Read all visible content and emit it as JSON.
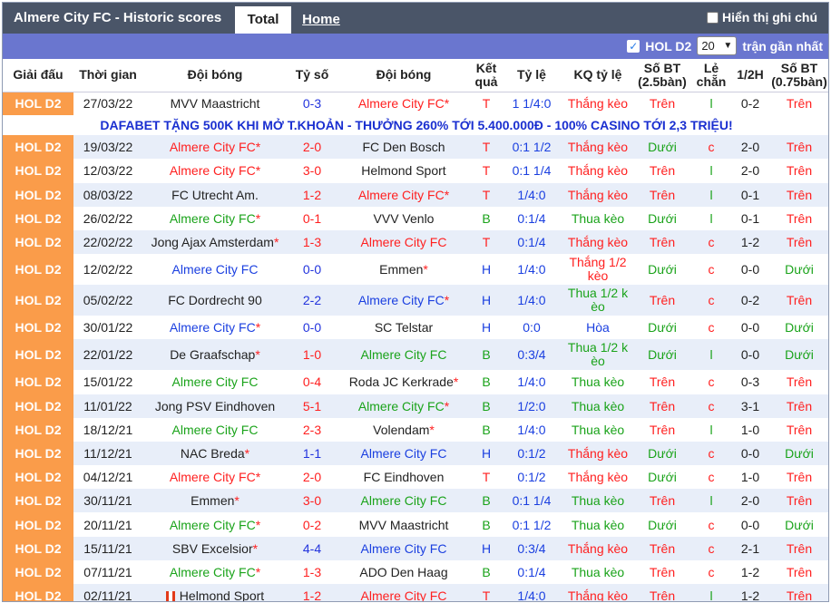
{
  "header": {
    "title": "Almere City FC - Historic scores",
    "tab_total": "Total",
    "tab_home": "Home",
    "hint": "Hiển thị ghi chú"
  },
  "filter": {
    "league": "HOL D2",
    "count": "20",
    "recent": "trận gần nhất"
  },
  "columns": [
    "Giải đấu",
    "Thời gian",
    "Đội bóng",
    "Tỷ số",
    "Đội bóng",
    "Kết quả",
    "Tỷ lệ",
    "KQ tỷ lệ",
    "Số BT (2.5bàn)",
    "Lẻ chẵn",
    "1/2H",
    "Số BT (0.75bàn)"
  ],
  "promo": "DAFABET TẶNG 500K KHI MỞ T.KHOẢN - THƯỞNG 260% TỚI 5.400.000Đ - 100% CASINO TỚI 2,3 TRIỆU!",
  "rows": [
    {
      "league": "HOL D2",
      "date": "27/03/22",
      "home": "MVV Maastricht",
      "home_star": false,
      "home_c": "blk",
      "score": "0-3",
      "sc": "blu",
      "away": "Almere City FC",
      "away_star": true,
      "away_c": "red",
      "res": "T",
      "res_c": "red",
      "odds": "1 1/4:0",
      "odds_c": "blu",
      "kq": "Thắng kèo",
      "kq_c": "red",
      "bt": "Trên",
      "bt_c": "red",
      "lc": "l",
      "lc_c": "grn",
      "h1": "0-2",
      "ou": "Trên",
      "ou_c": "red",
      "tall": false
    },
    {
      "league": "HOL D2",
      "date": "19/03/22",
      "home": "Almere City FC",
      "home_star": true,
      "home_c": "red",
      "score": "2-0",
      "sc": "red",
      "away": "FC Den Bosch",
      "away_star": false,
      "away_c": "blk",
      "res": "T",
      "res_c": "red",
      "odds": "0:1 1/2",
      "odds_c": "blu",
      "kq": "Thắng kèo",
      "kq_c": "red",
      "bt": "Dưới",
      "bt_c": "grn",
      "lc": "c",
      "lc_c": "red",
      "h1": "2-0",
      "ou": "Trên",
      "ou_c": "red",
      "tall": false
    },
    {
      "league": "HOL D2",
      "date": "12/03/22",
      "home": "Almere City FC",
      "home_star": true,
      "home_c": "red",
      "score": "3-0",
      "sc": "red",
      "away": "Helmond Sport",
      "away_star": false,
      "away_c": "blk",
      "res": "T",
      "res_c": "red",
      "odds": "0:1 1/4",
      "odds_c": "blu",
      "kq": "Thắng kèo",
      "kq_c": "red",
      "bt": "Trên",
      "bt_c": "red",
      "lc": "l",
      "lc_c": "grn",
      "h1": "2-0",
      "ou": "Trên",
      "ou_c": "red",
      "tall": false
    },
    {
      "league": "HOL D2",
      "date": "08/03/22",
      "home": "FC Utrecht Am.",
      "home_star": false,
      "home_c": "blk",
      "score": "1-2",
      "sc": "red",
      "away": "Almere City FC",
      "away_star": true,
      "away_c": "red",
      "res": "T",
      "res_c": "red",
      "odds": "1/4:0",
      "odds_c": "blu",
      "kq": "Thắng kèo",
      "kq_c": "red",
      "bt": "Trên",
      "bt_c": "red",
      "lc": "l",
      "lc_c": "grn",
      "h1": "0-1",
      "ou": "Trên",
      "ou_c": "red",
      "tall": false
    },
    {
      "league": "HOL D2",
      "date": "26/02/22",
      "home": "Almere City FC",
      "home_star": true,
      "home_c": "grn",
      "score": "0-1",
      "sc": "red",
      "away": "VVV Venlo",
      "away_star": false,
      "away_c": "blk",
      "res": "B",
      "res_c": "grn",
      "odds": "0:1/4",
      "odds_c": "blu",
      "kq": "Thua kèo",
      "kq_c": "grn",
      "bt": "Dưới",
      "bt_c": "grn",
      "lc": "l",
      "lc_c": "grn",
      "h1": "0-1",
      "ou": "Trên",
      "ou_c": "red",
      "tall": false
    },
    {
      "league": "HOL D2",
      "date": "22/02/22",
      "home": "Jong Ajax Amsterdam",
      "home_star": true,
      "home_c": "blk",
      "score": "1-3",
      "sc": "red",
      "away": "Almere City FC",
      "away_star": false,
      "away_c": "red",
      "res": "T",
      "res_c": "red",
      "odds": "0:1/4",
      "odds_c": "blu",
      "kq": "Thắng kèo",
      "kq_c": "red",
      "bt": "Trên",
      "bt_c": "red",
      "lc": "c",
      "lc_c": "red",
      "h1": "1-2",
      "ou": "Trên",
      "ou_c": "red",
      "tall": false
    },
    {
      "league": "HOL D2",
      "date": "12/02/22",
      "home": "Almere City FC",
      "home_star": false,
      "home_c": "blu",
      "score": "0-0",
      "sc": "blu",
      "away": "Emmen",
      "away_star": true,
      "away_c": "blk",
      "res": "H",
      "res_c": "blu",
      "odds": "1/4:0",
      "odds_c": "blu",
      "kq": "Thắng 1/2 kèo",
      "kq_c": "red",
      "bt": "Dưới",
      "bt_c": "grn",
      "lc": "c",
      "lc_c": "red",
      "h1": "0-0",
      "ou": "Dưới",
      "ou_c": "grn",
      "tall": true
    },
    {
      "league": "HOL D2",
      "date": "05/02/22",
      "home": "FC Dordrecht 90",
      "home_star": false,
      "home_c": "blk",
      "score": "2-2",
      "sc": "blu",
      "away": "Almere City FC",
      "away_star": true,
      "away_c": "blu",
      "res": "H",
      "res_c": "blu",
      "odds": "1/4:0",
      "odds_c": "blu",
      "kq": "Thua 1/2 k èo",
      "kq_c": "grn",
      "bt": "Trên",
      "bt_c": "red",
      "lc": "c",
      "lc_c": "red",
      "h1": "0-2",
      "ou": "Trên",
      "ou_c": "red",
      "tall": true
    },
    {
      "league": "HOL D2",
      "date": "30/01/22",
      "home": "Almere City FC",
      "home_star": true,
      "home_c": "blu",
      "score": "0-0",
      "sc": "blu",
      "away": "SC Telstar",
      "away_star": false,
      "away_c": "blk",
      "res": "H",
      "res_c": "blu",
      "odds": "0:0",
      "odds_c": "blu",
      "kq": "Hòa",
      "kq_c": "blu",
      "bt": "Dưới",
      "bt_c": "grn",
      "lc": "c",
      "lc_c": "red",
      "h1": "0-0",
      "ou": "Dưới",
      "ou_c": "grn",
      "tall": false
    },
    {
      "league": "HOL D2",
      "date": "22/01/22",
      "home": "De Graafschap",
      "home_star": true,
      "home_c": "blk",
      "score": "1-0",
      "sc": "red",
      "away": "Almere City FC",
      "away_star": false,
      "away_c": "grn",
      "res": "B",
      "res_c": "grn",
      "odds": "0:3/4",
      "odds_c": "blu",
      "kq": "Thua 1/2 k èo",
      "kq_c": "grn",
      "bt": "Dưới",
      "bt_c": "grn",
      "lc": "l",
      "lc_c": "grn",
      "h1": "0-0",
      "ou": "Dưới",
      "ou_c": "grn",
      "tall": true
    },
    {
      "league": "HOL D2",
      "date": "15/01/22",
      "home": "Almere City FC",
      "home_star": false,
      "home_c": "grn",
      "score": "0-4",
      "sc": "red",
      "away": "Roda JC Kerkrade",
      "away_star": true,
      "away_c": "blk",
      "res": "B",
      "res_c": "grn",
      "odds": "1/4:0",
      "odds_c": "blu",
      "kq": "Thua kèo",
      "kq_c": "grn",
      "bt": "Trên",
      "bt_c": "red",
      "lc": "c",
      "lc_c": "red",
      "h1": "0-3",
      "ou": "Trên",
      "ou_c": "red",
      "tall": false
    },
    {
      "league": "HOL D2",
      "date": "11/01/22",
      "home": "Jong PSV Eindhoven",
      "home_star": false,
      "home_c": "blk",
      "score": "5-1",
      "sc": "red",
      "away": "Almere City FC",
      "away_star": true,
      "away_c": "grn",
      "res": "B",
      "res_c": "grn",
      "odds": "1/2:0",
      "odds_c": "blu",
      "kq": "Thua kèo",
      "kq_c": "grn",
      "bt": "Trên",
      "bt_c": "red",
      "lc": "c",
      "lc_c": "red",
      "h1": "3-1",
      "ou": "Trên",
      "ou_c": "red",
      "tall": false
    },
    {
      "league": "HOL D2",
      "date": "18/12/21",
      "home": "Almere City FC",
      "home_star": false,
      "home_c": "grn",
      "score": "2-3",
      "sc": "red",
      "away": "Volendam",
      "away_star": true,
      "away_c": "blk",
      "res": "B",
      "res_c": "grn",
      "odds": "1/4:0",
      "odds_c": "blu",
      "kq": "Thua kèo",
      "kq_c": "grn",
      "bt": "Trên",
      "bt_c": "red",
      "lc": "l",
      "lc_c": "grn",
      "h1": "1-0",
      "ou": "Trên",
      "ou_c": "red",
      "tall": false
    },
    {
      "league": "HOL D2",
      "date": "11/12/21",
      "home": "NAC Breda",
      "home_star": true,
      "home_c": "blk",
      "score": "1-1",
      "sc": "blu",
      "away": "Almere City FC",
      "away_star": false,
      "away_c": "blu",
      "res": "H",
      "res_c": "blu",
      "odds": "0:1/2",
      "odds_c": "blu",
      "kq": "Thắng kèo",
      "kq_c": "red",
      "bt": "Dưới",
      "bt_c": "grn",
      "lc": "c",
      "lc_c": "red",
      "h1": "0-0",
      "ou": "Dưới",
      "ou_c": "grn",
      "tall": false
    },
    {
      "league": "HOL D2",
      "date": "04/12/21",
      "home": "Almere City FC",
      "home_star": true,
      "home_c": "red",
      "score": "2-0",
      "sc": "red",
      "away": "FC Eindhoven",
      "away_star": false,
      "away_c": "blk",
      "res": "T",
      "res_c": "red",
      "odds": "0:1/2",
      "odds_c": "blu",
      "kq": "Thắng kèo",
      "kq_c": "red",
      "bt": "Dưới",
      "bt_c": "grn",
      "lc": "c",
      "lc_c": "red",
      "h1": "1-0",
      "ou": "Trên",
      "ou_c": "red",
      "tall": false
    },
    {
      "league": "HOL D2",
      "date": "30/11/21",
      "home": "Emmen",
      "home_star": true,
      "home_c": "blk",
      "score": "3-0",
      "sc": "red",
      "away": "Almere City FC",
      "away_star": false,
      "away_c": "grn",
      "res": "B",
      "res_c": "grn",
      "odds": "0:1 1/4",
      "odds_c": "blu",
      "kq": "Thua kèo",
      "kq_c": "grn",
      "bt": "Trên",
      "bt_c": "red",
      "lc": "l",
      "lc_c": "grn",
      "h1": "2-0",
      "ou": "Trên",
      "ou_c": "red",
      "tall": false
    },
    {
      "league": "HOL D2",
      "date": "20/11/21",
      "home": "Almere City FC",
      "home_star": true,
      "home_c": "grn",
      "score": "0-2",
      "sc": "red",
      "away": "MVV Maastricht",
      "away_star": false,
      "away_c": "blk",
      "res": "B",
      "res_c": "grn",
      "odds": "0:1 1/2",
      "odds_c": "blu",
      "kq": "Thua kèo",
      "kq_c": "grn",
      "bt": "Dưới",
      "bt_c": "grn",
      "lc": "c",
      "lc_c": "red",
      "h1": "0-0",
      "ou": "Dưới",
      "ou_c": "grn",
      "tall": false
    },
    {
      "league": "HOL D2",
      "date": "15/11/21",
      "home": "SBV Excelsior",
      "home_star": true,
      "home_c": "blk",
      "score": "4-4",
      "sc": "blu",
      "away": "Almere City FC",
      "away_star": false,
      "away_c": "blu",
      "res": "H",
      "res_c": "blu",
      "odds": "0:3/4",
      "odds_c": "blu",
      "kq": "Thắng kèo",
      "kq_c": "red",
      "bt": "Trên",
      "bt_c": "red",
      "lc": "c",
      "lc_c": "red",
      "h1": "2-1",
      "ou": "Trên",
      "ou_c": "red",
      "tall": false
    },
    {
      "league": "HOL D2",
      "date": "07/11/21",
      "home": "Almere City FC",
      "home_star": true,
      "home_c": "grn",
      "score": "1-3",
      "sc": "red",
      "away": "ADO Den Haag",
      "away_star": false,
      "away_c": "blk",
      "res": "B",
      "res_c": "grn",
      "odds": "0:1/4",
      "odds_c": "blu",
      "kq": "Thua kèo",
      "kq_c": "grn",
      "bt": "Trên",
      "bt_c": "red",
      "lc": "c",
      "lc_c": "red",
      "h1": "1-2",
      "ou": "Trên",
      "ou_c": "red",
      "tall": false
    },
    {
      "league": "HOL D2",
      "date": "02/11/21",
      "home": "Helmond Sport",
      "home_star": false,
      "home_c": "blk",
      "home_flag": true,
      "score": "1-2",
      "sc": "red",
      "away": "Almere City FC",
      "away_star": false,
      "away_c": "red",
      "res": "T",
      "res_c": "red",
      "odds": "1/4:0",
      "odds_c": "blu",
      "kq": "Thắng kèo",
      "kq_c": "red",
      "bt": "Trên",
      "bt_c": "red",
      "lc": "l",
      "lc_c": "grn",
      "h1": "1-2",
      "ou": "Trên",
      "ou_c": "red",
      "tall": false
    }
  ]
}
